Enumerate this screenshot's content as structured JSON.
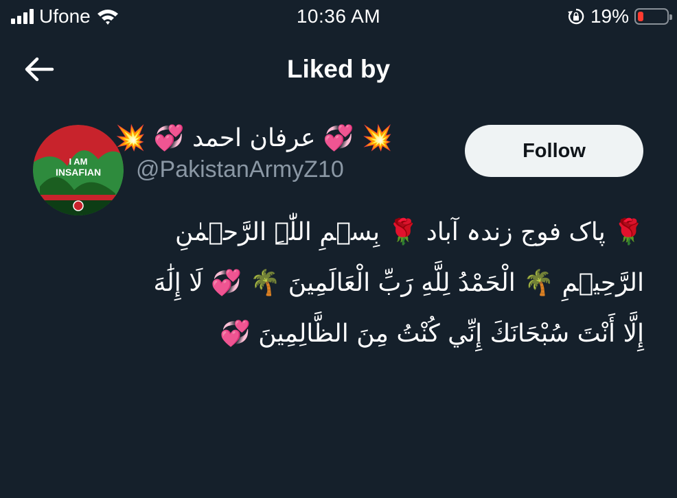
{
  "status_bar": {
    "carrier": "Ufone",
    "time": "10:36 AM",
    "battery_percent": "19%",
    "battery_level": 0.19,
    "battery_color": "#ff3b30",
    "icons": [
      "signal-bars-icon",
      "wifi-icon",
      "rotation-lock-icon",
      "battery-icon"
    ]
  },
  "header": {
    "title": "Liked by",
    "back_icon": "arrow-left-icon"
  },
  "users": [
    {
      "display_name": "💥 💞 عرفان احمد 💞 💥",
      "handle": "@PakistanArmyZ10",
      "avatar_text_line1": "I AM",
      "avatar_text_line2": "INSAFIAN",
      "follow_label": "Follow",
      "bio": "🌹 پاک فوج زندہ آباد 🌹 بِسۡمِ اللّٰہِ الرَّحۡمٰنِ الرَّحِیۡمِ 🌴 الْحَمْدُ لِلَّهِ رَبِّ الْعَالَمِينَ 🌴 💞 لَا إِلَٰهَ إِلَّا أَنْتَ سُبْحَانَكَ إِنِّي كُنْتُ مِنَ الظَّالِمِينَ 💞"
    }
  ],
  "colors": {
    "background": "#15202b",
    "text_primary": "#ffffff",
    "text_secondary": "#8b98a5",
    "follow_button_bg": "#eff3f4",
    "follow_button_text": "#0f1419"
  }
}
